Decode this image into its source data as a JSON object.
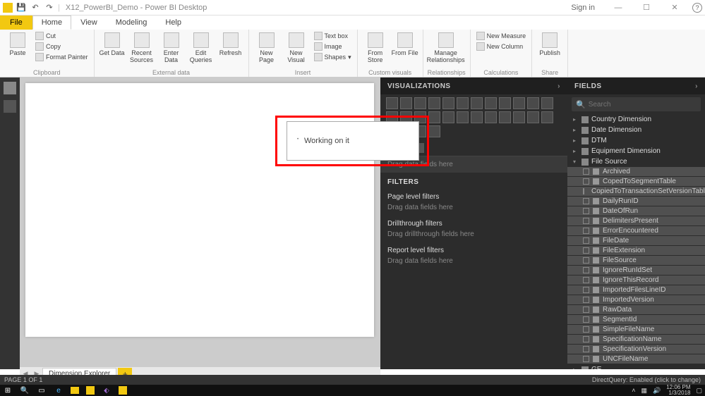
{
  "title": {
    "filename": "X12_PowerBI_Demo",
    "app": "Power BI Desktop",
    "signin": "Sign in"
  },
  "tabs": {
    "file": "File",
    "home": "Home",
    "view": "View",
    "modeling": "Modeling",
    "help": "Help"
  },
  "ribbon": {
    "clipboard": {
      "paste": "Paste",
      "cut": "Cut",
      "copy": "Copy",
      "format_painter": "Format Painter",
      "label": "Clipboard"
    },
    "external": {
      "get_data": "Get\nData",
      "recent": "Recent\nSources",
      "enter": "Enter\nData",
      "edit_q": "Edit\nQueries",
      "refresh": "Refresh",
      "label": "External data"
    },
    "insert": {
      "new_page": "New\nPage",
      "new_visual": "New\nVisual",
      "text_box": "Text box",
      "image": "Image",
      "shapes": "Shapes",
      "label": "Insert"
    },
    "custom": {
      "store": "From\nStore",
      "file": "From\nFile",
      "label": "Custom visuals"
    },
    "relationships": {
      "manage": "Manage\nRelationships",
      "label": "Relationships"
    },
    "calculations": {
      "new_measure": "New Measure",
      "new_column": "New Column",
      "label": "Calculations"
    },
    "share": {
      "publish": "Publish",
      "label": "Share"
    }
  },
  "working_msg": "Working on it",
  "viz": {
    "header": "VISUALIZATIONS",
    "drag_fields": "Drag data fields here",
    "filters_header": "FILTERS",
    "page_filters": "Page level filters",
    "drag_fields2": "Drag data fields here",
    "drill_filters": "Drillthrough filters",
    "drag_drill": "Drag drillthrough fields here",
    "report_filters": "Report level filters",
    "drag_fields3": "Drag data fields here"
  },
  "fields": {
    "header": "FIELDS",
    "search_placeholder": "Search",
    "tables": [
      {
        "name": "Country Dimension",
        "expanded": false
      },
      {
        "name": "Date Dimension",
        "expanded": false
      },
      {
        "name": "DTM",
        "expanded": false
      },
      {
        "name": "Equipment Dimension",
        "expanded": false
      },
      {
        "name": "File Source",
        "expanded": true,
        "cols": [
          "Archived",
          "CopedToSegmentTable",
          "CopiedToTransactionSetVersionTable",
          "DailyRunID",
          "DateOfRun",
          "DelimitersPresent",
          "ErrorEncountered",
          "FileDate",
          "FileExtension",
          "FileSource",
          "IgnoreRunIdSet",
          "IgnoreThisRecord",
          "ImportedFilesLineID",
          "ImportedVersion",
          "RawData",
          "SegmentId",
          "SimpleFileName",
          "SpecificationName",
          "SpecificationVersion",
          "UNCFileName"
        ]
      },
      {
        "name": "GE",
        "expanded": false
      }
    ]
  },
  "page_tabs": {
    "tab1": "Dimension Explorer"
  },
  "status": {
    "left": "PAGE 1 OF 1",
    "right": "DirectQuery: Enabled (click to change)"
  },
  "clock": {
    "time": "12:06 PM",
    "date": "1/3/2018"
  }
}
